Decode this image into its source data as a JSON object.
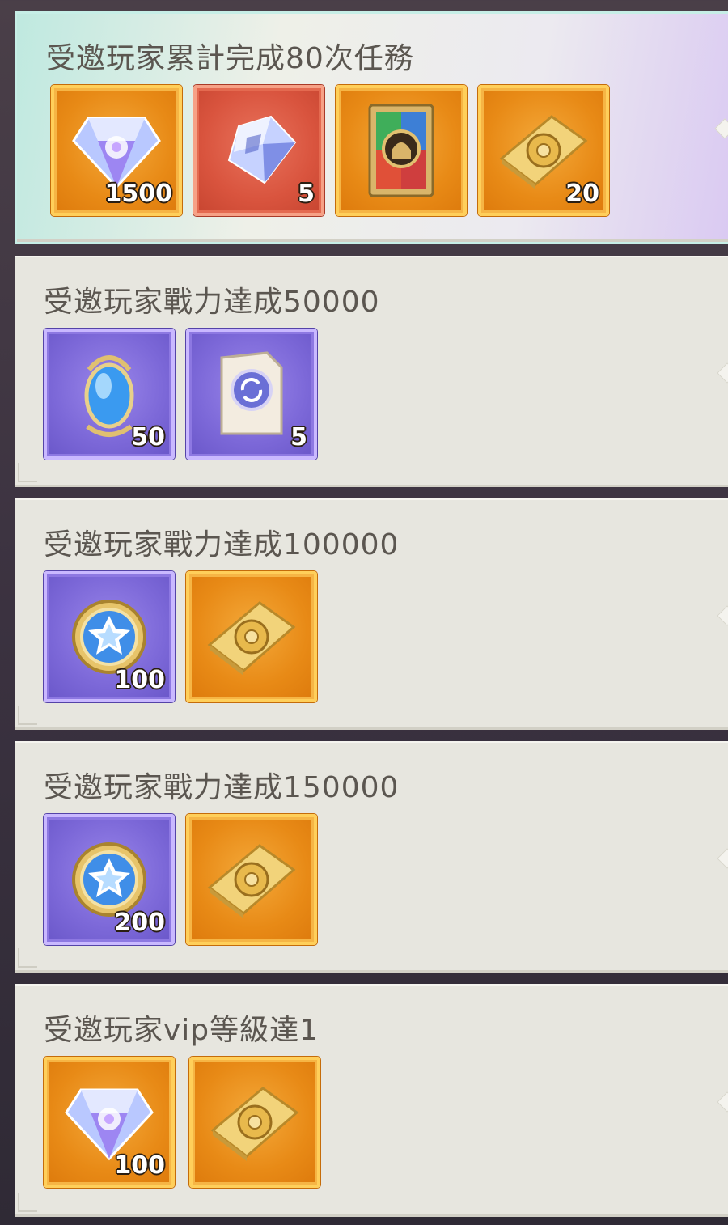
{
  "tasks": [
    {
      "title": "受邀玩家累計完成80次任務",
      "rewards": [
        {
          "icon": "diamond-gem-icon",
          "rarity": "orange",
          "qty": "1500"
        },
        {
          "icon": "crystal-cube-icon",
          "rarity": "red",
          "qty": "5"
        },
        {
          "icon": "helmet-card-icon",
          "rarity": "orange",
          "qty": ""
        },
        {
          "icon": "gold-book-icon",
          "rarity": "orange",
          "qty": "20"
        }
      ]
    },
    {
      "title": "受邀玩家戰力達成50000",
      "rewards": [
        {
          "icon": "blue-egg-gem-icon",
          "rarity": "purple",
          "qty": "50"
        },
        {
          "icon": "exchange-scroll-icon",
          "rarity": "purple",
          "qty": "5"
        }
      ]
    },
    {
      "title": "受邀玩家戰力達成100000",
      "rewards": [
        {
          "icon": "star-coin-icon",
          "rarity": "purple",
          "qty": "100"
        },
        {
          "icon": "gold-book-icon",
          "rarity": "orange",
          "qty": ""
        }
      ]
    },
    {
      "title": "受邀玩家戰力達成150000",
      "rewards": [
        {
          "icon": "star-coin-icon",
          "rarity": "purple",
          "qty": "200"
        },
        {
          "icon": "gold-book-icon",
          "rarity": "orange",
          "qty": ""
        }
      ]
    },
    {
      "title": "受邀玩家vip等級達1",
      "rewards": [
        {
          "icon": "diamond-gem-icon",
          "rarity": "orange",
          "qty": "100"
        },
        {
          "icon": "gold-book-icon",
          "rarity": "orange",
          "qty": ""
        }
      ]
    }
  ]
}
